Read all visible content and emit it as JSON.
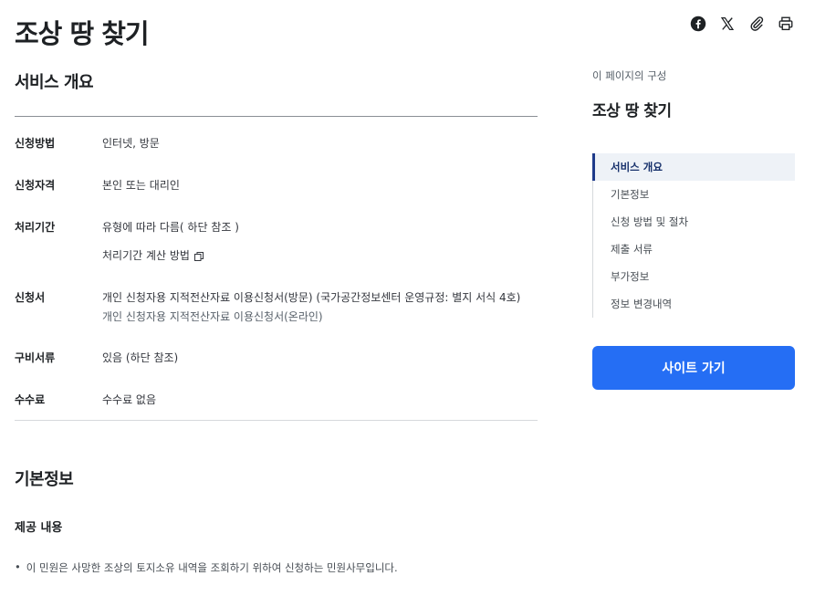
{
  "page": {
    "title": "조상 땅 찾기"
  },
  "share": {
    "icons": [
      "facebook-icon",
      "x-icon",
      "paperclip-icon",
      "print-icon"
    ]
  },
  "overview": {
    "title": "서비스 개요",
    "rows": {
      "method": {
        "key": "신청방법",
        "value": "인터넷, 방문"
      },
      "qualification": {
        "key": "신청자격",
        "value": "본인 또는 대리인"
      },
      "period": {
        "key": "처리기간",
        "value": "유형에 따라 다름( 하단 참조 )",
        "sub_link": "처리기간 계산 방법"
      },
      "form": {
        "key": "신청서",
        "line1": "개인 신청자용 지적전산자료 이용신청서(방문) (국가공간정보센터 운영규정: 별지 서식 4호)",
        "line2": "개인 신청자용 지적전산자료 이용신청서(온라인)"
      },
      "documents": {
        "key": "구비서류",
        "value": "있음 (하단 참조)"
      },
      "fee": {
        "key": "수수료",
        "value": "수수료 없음"
      }
    }
  },
  "basic_info": {
    "title": "기본정보",
    "provide_title": "제공 내용",
    "bullet": "이 민원은 사망한 조상의 토지소유 내역을 조회하기 위하여 신청하는 민원사무입니다."
  },
  "toc": {
    "caption": "이 페이지의 구성",
    "title": "조상 땅 찾기",
    "items": [
      "서비스 개요",
      "기본정보",
      "신청 방법 및 절차",
      "제출 서류",
      "부가정보",
      "정보 변경내역"
    ],
    "active_index": 0
  },
  "site_button": {
    "label": "사이트 가기"
  },
  "colors": {
    "accent": "#256ef4",
    "toc_active_bar": "#1e3a8a",
    "toc_active_bg": "#eef2f7"
  }
}
